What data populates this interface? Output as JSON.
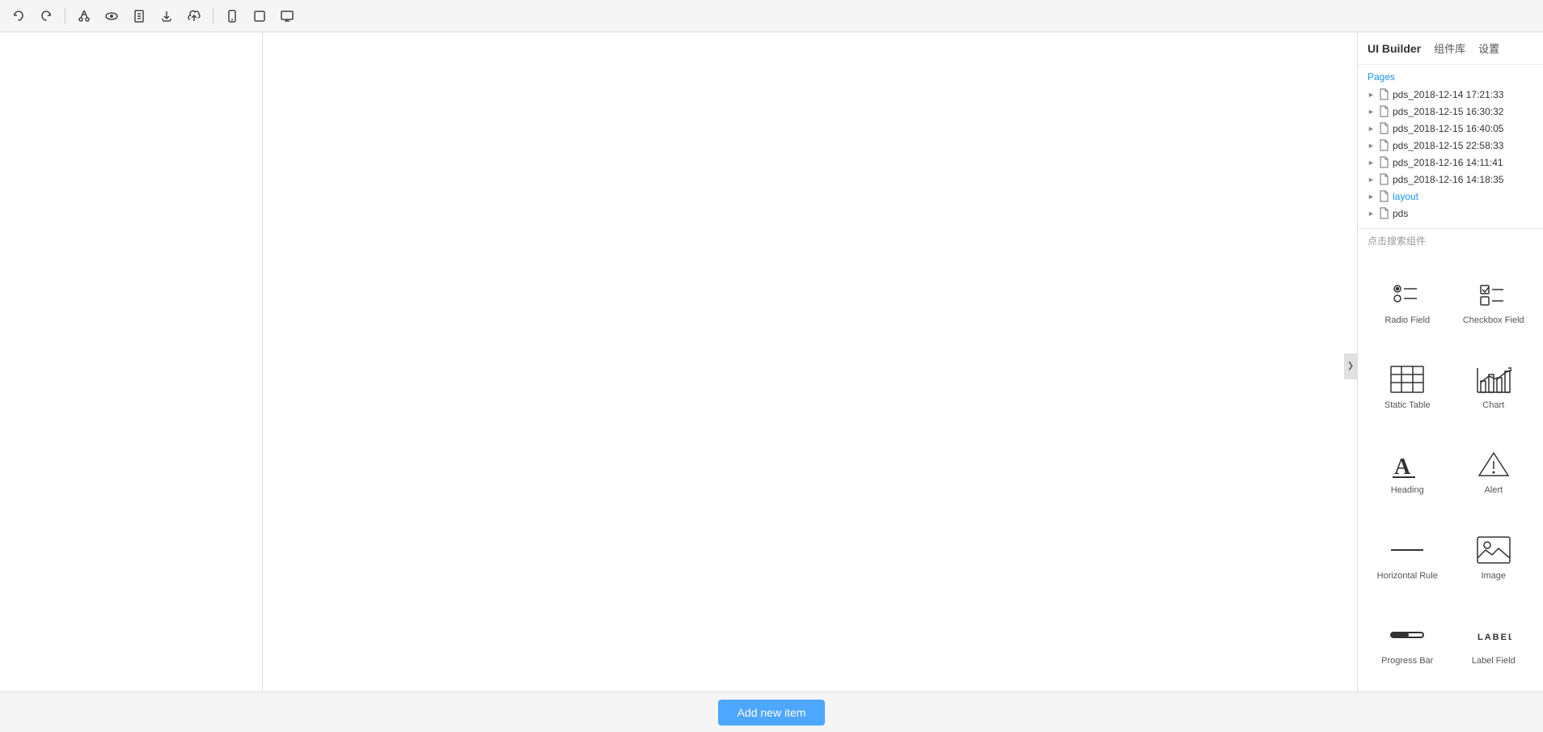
{
  "toolbar": {
    "buttons": [
      {
        "name": "undo",
        "label": "↩",
        "icon": "undo-icon"
      },
      {
        "name": "redo",
        "label": "↪",
        "icon": "redo-icon"
      },
      {
        "name": "cut",
        "label": "✂",
        "icon": "cut-icon"
      },
      {
        "name": "preview",
        "label": "👁",
        "icon": "eye-icon"
      },
      {
        "name": "file",
        "label": "📄",
        "icon": "file-icon"
      },
      {
        "name": "download",
        "label": "⬇",
        "icon": "download-icon"
      },
      {
        "name": "upload",
        "label": "☁",
        "icon": "upload-icon"
      },
      {
        "name": "mobile",
        "label": "📱",
        "icon": "mobile-icon"
      },
      {
        "name": "tablet",
        "label": "⬜",
        "icon": "tablet-icon"
      },
      {
        "name": "desktop",
        "label": "🖥",
        "icon": "desktop-icon"
      }
    ]
  },
  "sidebar": {
    "title": "UI Builder",
    "tab_components": "组件库",
    "tab_settings": "设置",
    "pages_label": "Pages",
    "search_placeholder": "点击搜索组件",
    "pages": [
      {
        "id": "p1",
        "name": "pds_2018-12-14 17:21:33",
        "active": false
      },
      {
        "id": "p2",
        "name": "pds_2018-12-15 16:30:32",
        "active": false
      },
      {
        "id": "p3",
        "name": "pds_2018-12-15 16:40:05",
        "active": false
      },
      {
        "id": "p4",
        "name": "pds_2018-12-15 22:58:33",
        "active": false
      },
      {
        "id": "p5",
        "name": "pds_2018-12-16 14:11:41",
        "active": false
      },
      {
        "id": "p6",
        "name": "pds_2018-12-16 14:18:35",
        "active": false
      },
      {
        "id": "p7",
        "name": "layout",
        "active": true
      },
      {
        "id": "p8",
        "name": "pds",
        "active": false
      }
    ],
    "components": [
      {
        "id": "radio-field",
        "label": "Radio Field",
        "icon": "radio-icon"
      },
      {
        "id": "checkbox-field",
        "label": "Checkbox Field",
        "icon": "checkbox-icon"
      },
      {
        "id": "static-table",
        "label": "Static Table",
        "icon": "table-icon"
      },
      {
        "id": "chart",
        "label": "Chart",
        "icon": "chart-icon"
      },
      {
        "id": "heading",
        "label": "Heading",
        "icon": "heading-icon"
      },
      {
        "id": "alert",
        "label": "Alert",
        "icon": "alert-icon"
      },
      {
        "id": "horizontal-rule",
        "label": "Horizontal Rule",
        "icon": "hr-icon"
      },
      {
        "id": "image",
        "label": "Image",
        "icon": "image-icon"
      },
      {
        "id": "progress-bar",
        "label": "Progress Bar",
        "icon": "progress-icon"
      },
      {
        "id": "label-field",
        "label": "Label Field",
        "icon": "label-icon"
      }
    ]
  },
  "canvas": {
    "add_button_label": "Add new item"
  },
  "colors": {
    "accent": "#1a90ff",
    "add_btn": "#4da6ff"
  }
}
